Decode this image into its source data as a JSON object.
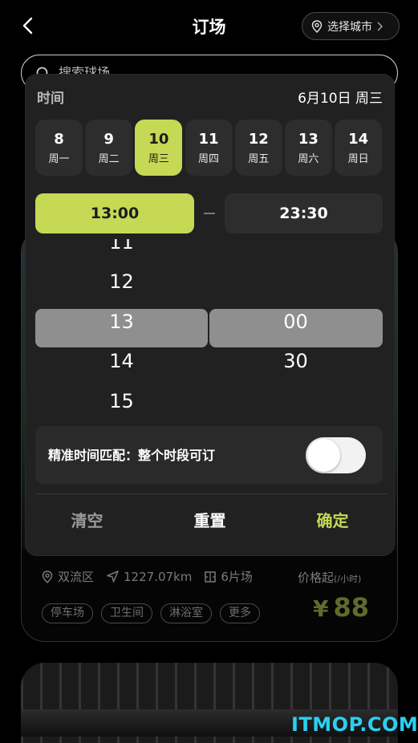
{
  "header": {
    "title": "订场",
    "city_label": "选择城市"
  },
  "search": {
    "placeholder": "搜索球场"
  },
  "venue": {
    "district": "双流区",
    "distance": "1227.07km",
    "courts": "6片场",
    "price_label": "价格起",
    "price_unit": "(/小时)",
    "currency": "¥",
    "price": "88",
    "tags": [
      "停车场",
      "卫生间",
      "淋浴室",
      "更多"
    ]
  },
  "modal": {
    "time_label": "时间",
    "selected_date": "6月10日 周三",
    "days": [
      {
        "num": "8",
        "weekday": "周一"
      },
      {
        "num": "9",
        "weekday": "周二"
      },
      {
        "num": "10",
        "weekday": "周三"
      },
      {
        "num": "11",
        "weekday": "周四"
      },
      {
        "num": "12",
        "weekday": "周五"
      },
      {
        "num": "13",
        "weekday": "周六"
      },
      {
        "num": "14",
        "weekday": "周日"
      }
    ],
    "selected_day_index": 2,
    "start_time": "13:00",
    "end_time": "23:30",
    "hour_options": [
      "11",
      "12",
      "13",
      "14",
      "15"
    ],
    "minute_options": [
      "00",
      "30"
    ],
    "selected_hour": "13",
    "selected_minute": "00",
    "exact_match_label": "精准时间匹配：整个时段可订",
    "exact_match_on": false,
    "actions": {
      "clear": "清空",
      "reset": "重置",
      "confirm": "确定"
    }
  },
  "watermark": "ITMOP.COM",
  "colors": {
    "accent": "#c5d955",
    "modal_bg": "#212121",
    "tile_bg": "#2d2d2d"
  }
}
